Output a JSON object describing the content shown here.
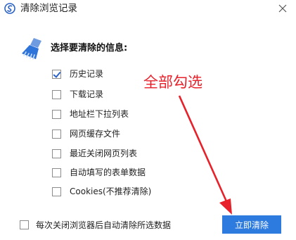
{
  "window": {
    "title": "清除浏览记录",
    "close_glyph": "✕"
  },
  "dialog": {
    "heading": "选择要清除的信息:"
  },
  "options": [
    {
      "label": "历史记录",
      "checked": true
    },
    {
      "label": "下载记录",
      "checked": false
    },
    {
      "label": "地址栏下拉列表",
      "checked": false
    },
    {
      "label": "网页缓存文件",
      "checked": false
    },
    {
      "label": "最近关闭网页列表",
      "checked": false
    },
    {
      "label": "自动填写的表单数据",
      "checked": false
    },
    {
      "label": "Cookies(不推荐清除)",
      "checked": false
    }
  ],
  "footer": {
    "auto_clear_label": "每次关闭浏览器后自动清除所选数据",
    "auto_clear_checked": false,
    "confirm_button": "立即清除"
  },
  "annotation": {
    "text": "全部勾选",
    "color": "#e8202a"
  },
  "icons": {
    "app": "browser-logo-icon",
    "heading": "broom-icon"
  },
  "colors": {
    "accent": "#2e7be0",
    "checkmark": "#2b63c9"
  }
}
